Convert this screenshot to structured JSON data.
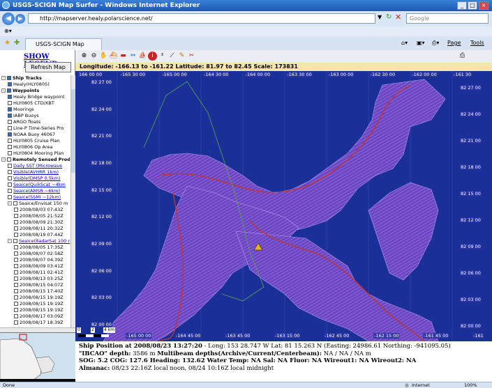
{
  "window": {
    "title": "USGS-SCIGN Map Surfer - Windows Internet Explorer",
    "url": "http://mapserver.healy.polarscience.net/",
    "search_placeholder": "Google",
    "tab_title": "USGS-SCIGN Map Surfer",
    "page_menu": "Page",
    "tools_menu": "Tools"
  },
  "left_panel": {
    "legend_link": "SHOW LEGEND",
    "refresh_button": "Refresh Map",
    "tree": [
      {
        "label": "Ship Tracks",
        "level": 0,
        "expander": "-",
        "checked": true,
        "bold": true
      },
      {
        "label": "Healy(HLY0805)",
        "level": 1,
        "checked": true
      },
      {
        "label": "Waypoints",
        "level": 0,
        "expander": "-",
        "checked": true,
        "bold": true
      },
      {
        "label": "Healy Bridge waypoint",
        "level": 1,
        "checked": true
      },
      {
        "label": "HLY0805 CTD/XBT",
        "level": 1,
        "checked": false
      },
      {
        "label": "Moorings",
        "level": 1,
        "checked": true
      },
      {
        "label": "IABP Buoys",
        "level": 1,
        "checked": true
      },
      {
        "label": "ARGO floats",
        "level": 1,
        "checked": false
      },
      {
        "label": "Line-P Time-Series Pro",
        "level": 1,
        "checked": false
      },
      {
        "label": "NOAA Buoy 46067",
        "level": 1,
        "checked": true
      },
      {
        "label": "HLY0805 Cruise Plan",
        "level": 1,
        "checked": false
      },
      {
        "label": "HLY0806 Op Area",
        "level": 1,
        "checked": false
      },
      {
        "label": "HLY0804 Mooring Plan",
        "level": 1,
        "checked": false
      },
      {
        "label": "Remotely Sensed Prod",
        "level": 0,
        "expander": "-",
        "checked": false,
        "bold": true
      },
      {
        "label": "Daily SST (Microwave",
        "level": 1,
        "checked": false,
        "link": true
      },
      {
        "label": "Visible(AVHRR 1km)",
        "level": 1,
        "checked": false,
        "link": true
      },
      {
        "label": "Visible(DMSP 0.5km)",
        "level": 1,
        "checked": false,
        "link": true
      },
      {
        "label": "Seaice(QuikScat ~4km",
        "level": 1,
        "checked": false,
        "link": true
      },
      {
        "label": "Seaice(AMSR ~6km)",
        "level": 1,
        "checked": false,
        "link": true
      },
      {
        "label": "Seaice(SSMI ~12km)",
        "level": 1,
        "checked": false,
        "link": true
      },
      {
        "label": "Seaice/Envisat 150 m",
        "level": 1,
        "expander": "-",
        "checked": false
      },
      {
        "label": "2008/08/03 07:43Z",
        "level": 2,
        "checked": false
      },
      {
        "label": "2008/08/05 21:52Z",
        "level": 2,
        "checked": false
      },
      {
        "label": "2008/08/09 21:30Z",
        "level": 2,
        "checked": false
      },
      {
        "label": "2008/08/11 20:32Z",
        "level": 2,
        "checked": false
      },
      {
        "label": "2008/08/19 07:44Z",
        "level": 2,
        "checked": false
      },
      {
        "label": "Seaice(RadarSat 100 r",
        "level": 1,
        "expander": "-",
        "checked": false,
        "link": true
      },
      {
        "label": "2008/08/05 17:35Z",
        "level": 2,
        "checked": false
      },
      {
        "label": "2008/08/07 02:58Z",
        "level": 2,
        "checked": false
      },
      {
        "label": "2008/08/07 04:39Z",
        "level": 2,
        "checked": false
      },
      {
        "label": "2008/08/09 03:41Z",
        "level": 2,
        "checked": false
      },
      {
        "label": "2008/08/11 02:41Z",
        "level": 2,
        "checked": false
      },
      {
        "label": "2008/08/13 03:25Z",
        "level": 2,
        "checked": false
      },
      {
        "label": "2008/08/15 04:07Z",
        "level": 2,
        "checked": false
      },
      {
        "label": "2008/08/15 17:40Z",
        "level": 2,
        "checked": false
      },
      {
        "label": "2008/08/15 19:19Z",
        "level": 2,
        "checked": false
      },
      {
        "label": "2008/08/15 19:19Z",
        "level": 2,
        "checked": false
      },
      {
        "label": "2008/08/15 19:19Z",
        "level": 2,
        "checked": false
      },
      {
        "label": "2008/08/17 03:09Z",
        "level": 2,
        "checked": false
      },
      {
        "label": "2008/08/17 18:39Z",
        "level": 2,
        "checked": false
      }
    ]
  },
  "map": {
    "coords_text": "Longitude: -166.13 to -161.22   Latitude: 81.97 to 82.45   Scale: 173831",
    "top_lon_labels": [
      "166 00 00",
      "-165 30 00",
      "-165 00 00",
      "-164 30 00",
      "-164 00 00",
      "-163 30 00",
      "-163 00 00",
      "-162 30 00",
      "-162 00 00",
      "-161 30"
    ],
    "bottom_lon_labels": [
      "-165 00 00",
      "-164 45 00",
      "-163 45 00",
      "-163 15 00",
      "-162 45 00",
      "-162 15 00",
      "-161 45 00",
      "-161"
    ],
    "left_lat_labels": [
      "82 27 00",
      "82 24 00",
      "82 21 00",
      "82 18 00",
      "82 15 00",
      "82 12 00",
      "82 09 00",
      "82 06 00",
      "82 03 00",
      "82 00 00"
    ],
    "right_lat_labels": [
      "82 27 00",
      "82 24 00",
      "82 21 00",
      "82 18 00",
      "82 15 00",
      "82 12 00",
      "82 09 00",
      "82 06 00",
      "82 03 00",
      "82 00 00"
    ],
    "scale_label_0": "0",
    "scale_label_2": "2",
    "scale_label_4": "4 km",
    "colors": {
      "water": "#1a2f9a",
      "swath": "#7a4fd0",
      "track": "#c03434",
      "plan": "#58a848"
    }
  },
  "info": {
    "line1_label": "Ship Position at 2008/08/23 13:27:20",
    "line1_rest": " - Long: 153 28.747 W  Lat: 81 15.263 N (Easting: 24986.61 Northing: -941095.05)",
    "line2_label": "\"IBCAO\" depth:",
    "line2_rest": " 3586 m  ",
    "line2_label2": "Multibeam depths(Archive/Current/Centerbeam):",
    "line2_rest2": " NA / NA / NA m",
    "line3": "SOG: 5.2 COG: 127.6 Heading: 132.62 Water Temp: NA Sal: NA Fluor: NA Wireout1: NA Wireout2: NA",
    "line4_label": "Almanac:",
    "line4_rest": " 08/23 22:16Z local noon,  08/24 10:16Z local midnight"
  },
  "status": {
    "left": "Done",
    "zone": "Internet",
    "zoom": "100%"
  }
}
